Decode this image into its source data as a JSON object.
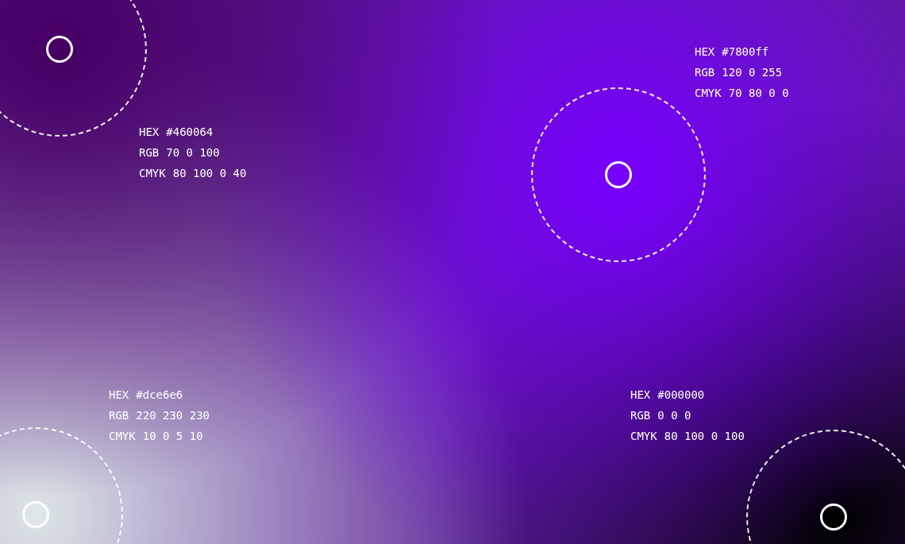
{
  "points": [
    {
      "color": "#460064",
      "rows": [
        {
          "label": "HEX",
          "value": "#460064"
        },
        {
          "label": "RGB",
          "value": "70 0 100"
        },
        {
          "label": "CMYK",
          "value": "80 100 0 40"
        }
      ]
    },
    {
      "color": "#7800ff",
      "rows": [
        {
          "label": "HEX",
          "value": "#7800ff"
        },
        {
          "label": "RGB",
          "value": "120 0 255"
        },
        {
          "label": "CMYK",
          "value": "70 80 0 0"
        }
      ]
    },
    {
      "color": "#dce6e6",
      "rows": [
        {
          "label": "HEX",
          "value": "#dce6e6"
        },
        {
          "label": "RGB",
          "value": "220 230 230"
        },
        {
          "label": "CMYK",
          "value": "10 0 5 10"
        }
      ]
    },
    {
      "color": "#000000",
      "rows": [
        {
          "label": "HEX",
          "value": "#000000"
        },
        {
          "label": "RGB",
          "value": "0 0 0"
        },
        {
          "label": "CMYK",
          "value": "80 100 0 100"
        }
      ]
    }
  ]
}
